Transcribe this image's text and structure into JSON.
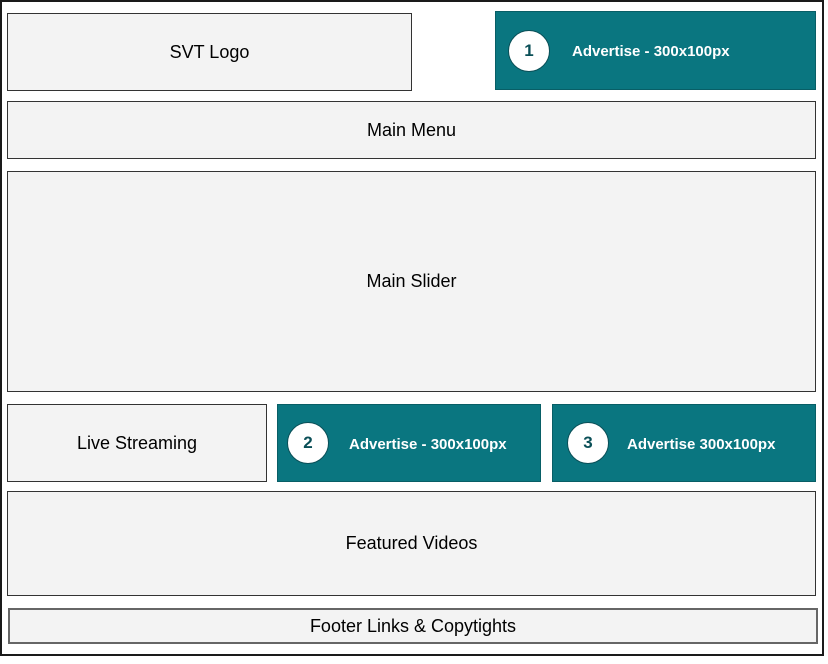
{
  "header": {
    "logo_label": "SVT Logo",
    "ad1": {
      "number": "1",
      "label": "Advertise - 300x100px"
    }
  },
  "menu": {
    "label": "Main Menu"
  },
  "slider": {
    "label": "Main Slider"
  },
  "row": {
    "live_label": "Live Streaming",
    "ad2": {
      "number": "2",
      "label": "Advertise - 300x100px"
    },
    "ad3": {
      "number": "3",
      "label": "Advertise 300x100px"
    }
  },
  "featured": {
    "label": "Featured Videos"
  },
  "footer": {
    "label": "Footer Links & Copytights"
  },
  "colors": {
    "ad_fill": "#0a7680",
    "box_fill": "#f3f3f3",
    "badge_text": "#0a4f57"
  }
}
